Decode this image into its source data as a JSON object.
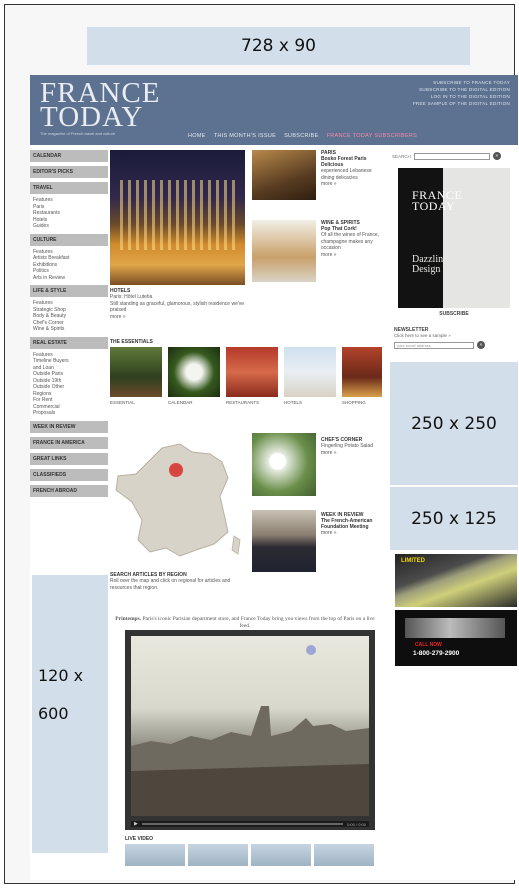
{
  "ads": {
    "leaderboard": "728 x 90",
    "mpu": "250 x 250",
    "half": "250 x 125",
    "skyscraper_1": "120 x",
    "skyscraper_2": "600"
  },
  "header": {
    "logo_line1": "FRANCE",
    "logo_line2": "TODAY",
    "tagline": "The magazine of French travel and culture",
    "top_links": [
      "SUBSCRIBE TO FRANCE TODAY",
      "SUBSCRIBE TO THE DIGITAL EDITION",
      "LOG IN TO THE DIGITAL EDITION",
      "FREE SAMPLE OF THE DIGITAL EDITION"
    ],
    "nav": [
      "HOME",
      "THIS MONTH'S ISSUE",
      "SUBSCRIBE",
      "FRANCE TODAY SUBSCRIBERS"
    ],
    "nav_highlight_color": "#f28ab0"
  },
  "left_nav": [
    {
      "head": "CALENDAR",
      "items": []
    },
    {
      "head": "EDITOR'S PICKS",
      "items": []
    },
    {
      "head": "TRAVEL",
      "items": [
        "Features",
        "Paris",
        "Restaurants",
        "Hotels",
        "Guides"
      ]
    },
    {
      "head": "CULTURE",
      "items": [
        "Features",
        "Artists Breakfast",
        "Exhibitions",
        "Politics",
        "Arts in Review"
      ]
    },
    {
      "head": "LIFE & STYLE",
      "items": [
        "Features",
        "Strategic Shop",
        "Body & Beauty",
        "Chef's Corner",
        "Wine & Spirits"
      ]
    },
    {
      "head": "REAL ESTATE",
      "items": [
        "Features",
        "Timeline Buyers",
        "  and Loan",
        "Outside Paris",
        "Outside 19th",
        "Outside Other",
        "  Regions",
        "For Rent",
        "Commercial",
        "  Proposals"
      ]
    },
    {
      "head": "WEEK IN REVIEW",
      "items": []
    },
    {
      "head": "FRANCE IN AMERICA",
      "items": []
    },
    {
      "head": "GREAT LINKS",
      "items": []
    },
    {
      "head": "CLASSIFIEDS",
      "items": []
    },
    {
      "head": "FRENCH ABROAD",
      "items": []
    }
  ],
  "hero": {
    "section": "HOTELS",
    "title": "Paris: Hôtel Lutetia",
    "text": "Still standing as graceful, glamorous, stylish residence we've praised",
    "more": "more »"
  },
  "side_stories": [
    {
      "section": "PARIS",
      "title": "Bosko Forest Paris Delicious",
      "text": "experienced Lebanese dining delicacies",
      "more": "more »"
    },
    {
      "section": "WINE & SPIRITS",
      "title": "Pop That Cork!",
      "text": "Of all the wines of France, champagne makes any occasion",
      "more": "more »"
    }
  ],
  "essentials": {
    "heading": "THE ESSENTIALS",
    "items": [
      "ESSENTIAL",
      "CALENDAR",
      "RESTAURANTS",
      "HOTELS",
      "SHOPPING"
    ]
  },
  "chefs": {
    "section": "CHEF'S CORNER",
    "title": "Fingerling Potato Salad",
    "more": "more »"
  },
  "week": {
    "section": "WEEK IN REVIEW",
    "title": "The French-American Foundation Meeting",
    "more": "more »"
  },
  "search_region": {
    "heading": "SEARCH ARTICLES BY REGION",
    "text": "Roll over the map and click on regional for articles and resources that region."
  },
  "video_intro": {
    "lead": "Printemps.",
    "text": " Paris's iconic Parisian department store, and France Today bring you views from the top of Paris on a live feed."
  },
  "video": {
    "time": "0:00 / 0:00",
    "play": "▶"
  },
  "live_video": {
    "heading": "LIVE VIDEO"
  },
  "right_col": {
    "search_label": "SEARCH",
    "search_btn": "»",
    "cover_logo1": "FRANCE",
    "cover_logo2": "TODAY",
    "cover_text1": "Dazzling",
    "cover_text2": "Design",
    "subscribe": "SUBSCRIBE",
    "newsletter_head": "NEWSLETTER",
    "newsletter_text": "Click here to see a sample »",
    "newsletter_placeholder": "your email address",
    "newsletter_btn": "»"
  },
  "ads_small": {
    "ad1_title": "LIMITED",
    "ad2_call": "CALL NOW",
    "ad2_phone": "1-800-279-2900"
  }
}
